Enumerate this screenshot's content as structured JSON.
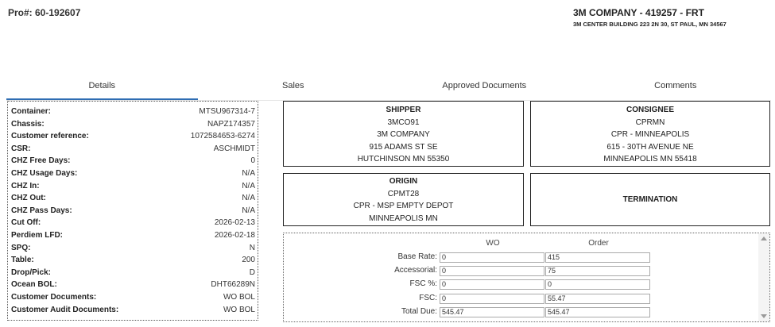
{
  "header": {
    "pro": "Pro#: 60-192607",
    "company_name": "3M COMPANY - 419257 - FRT",
    "company_address": "3M CENTER BUILDING 223 2N 30, ST PAUL, MN 34567"
  },
  "tabs": [
    {
      "label": "Details",
      "active": true
    },
    {
      "label": "Sales",
      "active": false
    },
    {
      "label": "Approved Documents",
      "active": false
    },
    {
      "label": "Comments",
      "active": false
    }
  ],
  "details": [
    {
      "label": "Container:",
      "value": "MTSU967314-7"
    },
    {
      "label": "Chassis:",
      "value": "NAPZ174357"
    },
    {
      "label": "Customer reference:",
      "value": "1072584653-6274"
    },
    {
      "label": "CSR:",
      "value": "ASCHMIDT"
    },
    {
      "label": "CHZ Free Days:",
      "value": "0"
    },
    {
      "label": "CHZ Usage Days:",
      "value": "N/A"
    },
    {
      "label": "CHZ In:",
      "value": "N/A"
    },
    {
      "label": "CHZ Out:",
      "value": "N/A"
    },
    {
      "label": "CHZ Pass Days:",
      "value": "N/A"
    },
    {
      "label": "Cut Off:",
      "value": "2026-02-13"
    },
    {
      "label": "Perdiem LFD:",
      "value": "2026-02-18"
    },
    {
      "label": "SPQ:",
      "value": "N"
    },
    {
      "label": "Table:",
      "value": "200"
    },
    {
      "label": "Drop/Pick:",
      "value": "D"
    },
    {
      "label": "Ocean BOL:",
      "value": "DHT66289N"
    },
    {
      "label": "Customer Documents:",
      "value": "WO BOL"
    },
    {
      "label": "Customer Audit Documents:",
      "value": "WO BOL"
    }
  ],
  "shipper": {
    "title": "SHIPPER",
    "lines": [
      "3MCO91",
      "3M COMPANY",
      "915 ADAMS ST SE",
      "HUTCHINSON MN 55350"
    ]
  },
  "consignee": {
    "title": "CONSIGNEE",
    "lines": [
      "CPRMN",
      "CPR - MINNEAPOLIS",
      "615 - 30TH AVENUE NE",
      "MINNEAPOLIS MN 55418"
    ]
  },
  "origin": {
    "title": "ORIGIN",
    "lines": [
      "CPMT28",
      "CPR - MSP EMPTY DEPOT",
      "MINNEAPOLIS MN"
    ]
  },
  "termination": {
    "title": "TERMINATION"
  },
  "financials": {
    "col_wo": "WO",
    "col_order": "Order",
    "rows": [
      {
        "label": "Base Rate:",
        "wo": "0",
        "order": "415"
      },
      {
        "label": "Accessorial:",
        "wo": "0",
        "order": "75"
      },
      {
        "label": "FSC %:",
        "wo": "0",
        "order": "0"
      },
      {
        "label": "FSC:",
        "wo": "0",
        "order": "55.47"
      },
      {
        "label": "Total Due:",
        "wo": "545.47",
        "order": "545.47"
      }
    ]
  }
}
